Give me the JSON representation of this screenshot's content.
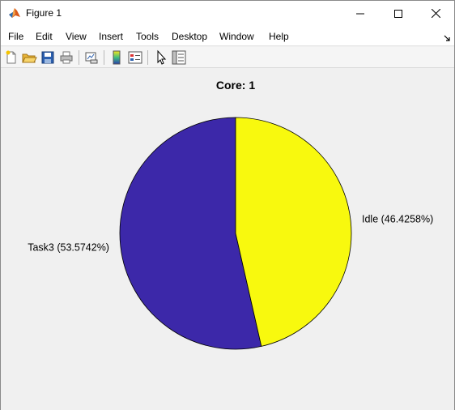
{
  "window": {
    "title": "Figure 1"
  },
  "menu": {
    "items": [
      "File",
      "Edit",
      "View",
      "Insert",
      "Tools",
      "Desktop",
      "Window",
      "Help"
    ]
  },
  "toolbar": {
    "icons": [
      "new-figure-icon",
      "open-file-icon",
      "save-icon",
      "print-icon",
      "link-plot-icon",
      "colorbar-icon",
      "legend-icon",
      "pointer-icon",
      "property-editor-icon"
    ]
  },
  "colors": {
    "task3": "#3c28a9",
    "idle": "#f8f90e"
  },
  "chart_data": {
    "type": "pie",
    "title": "Core: 1",
    "labels": [
      "Task3 (53.5742%)",
      "Idle (46.4258%)"
    ],
    "categories": [
      "Task3",
      "Idle"
    ],
    "values": [
      53.5742,
      46.4258
    ],
    "units": "%"
  }
}
